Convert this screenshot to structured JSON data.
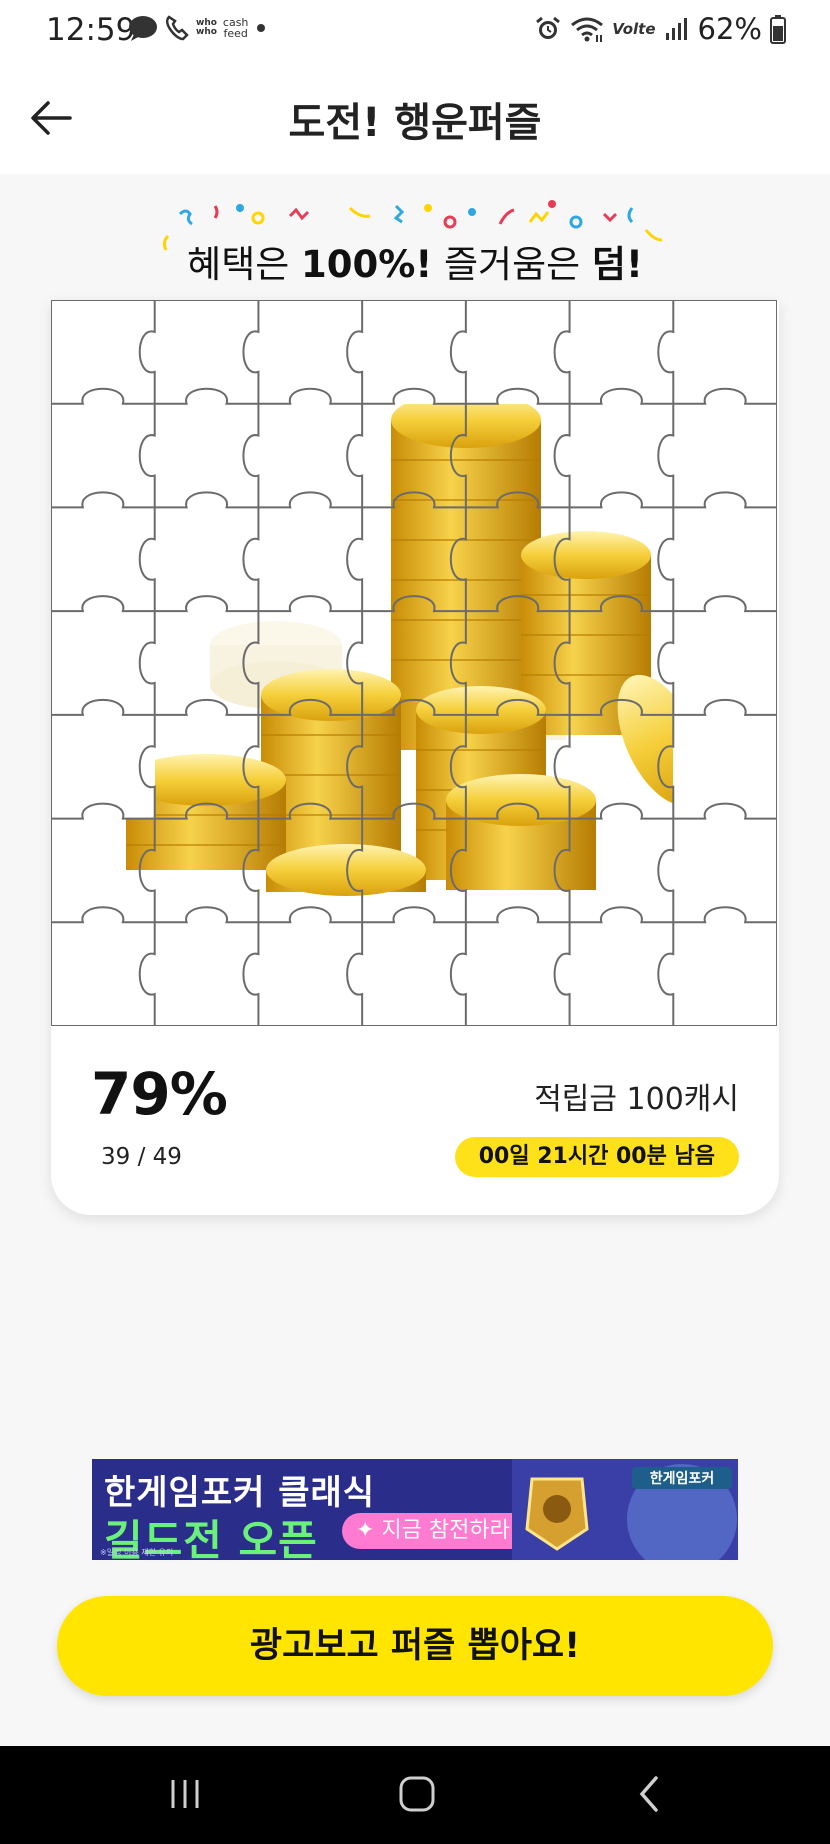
{
  "status_bar": {
    "time": "12:59",
    "notification_labels": {
      "who": "who\nwho",
      "cashfeed": "cash\nfeed"
    },
    "network_label": "Volte",
    "battery_percent": "62%",
    "icons": [
      "chat-bubble-icon",
      "phone-icon",
      "whowho-icon",
      "cashfeed-icon",
      "dot-icon",
      "alarm-icon",
      "wifi-icon",
      "volte-icon",
      "signal-icon",
      "battery-icon"
    ]
  },
  "header": {
    "title": "도전! 행운퍼즐",
    "back_icon": "arrow-left-icon"
  },
  "tagline": {
    "prefix": "혜택은 ",
    "strong1": "100%!",
    "middle": " 즐거움은 ",
    "strong2": "덤!"
  },
  "puzzle": {
    "total_pieces": 49,
    "collected_pieces": 39,
    "grid_size": 7,
    "image": "gold-coins-stack"
  },
  "progress": {
    "percent_label": "79%",
    "count_label": "39 / 49",
    "fraction": 0.79
  },
  "reward": {
    "label": "적립금 100캐시",
    "time_left": "00일 21시간 00분 남음"
  },
  "ad": {
    "line1": "한게임포커 클래식",
    "line2": "길드전 오픈",
    "cta": "✦ 지금 참전하라!",
    "small_text": "※일정 이용 제한 유의",
    "badge_text": "한게임포커"
  },
  "cta_button": {
    "label": "광고보고 퍼즐 뽑아요!"
  },
  "colors": {
    "accent_yellow": "#ffe500",
    "timer_yellow": "#ffe11a",
    "coin_gold": "#e8b415",
    "ad_bg": "#2a2d8a",
    "ad_green": "#6cf07c",
    "ad_pink": "#ff7ad1"
  },
  "nav_bar": {
    "icons": [
      "recent-apps-icon",
      "home-icon",
      "back-nav-icon"
    ]
  }
}
